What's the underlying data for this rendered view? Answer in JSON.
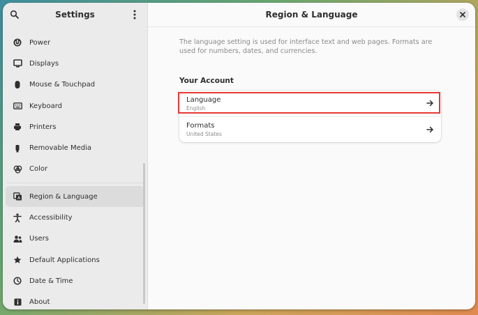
{
  "sidebar": {
    "title": "Settings",
    "items": [
      {
        "label": "Power",
        "icon": "power-icon"
      },
      {
        "label": "Displays",
        "icon": "display-icon"
      },
      {
        "label": "Mouse & Touchpad",
        "icon": "mouse-icon"
      },
      {
        "label": "Keyboard",
        "icon": "keyboard-icon"
      },
      {
        "label": "Printers",
        "icon": "printer-icon"
      },
      {
        "label": "Removable Media",
        "icon": "usb-icon"
      },
      {
        "label": "Color",
        "icon": "color-icon"
      },
      {
        "label": "Region & Language",
        "icon": "region-icon",
        "active": true
      },
      {
        "label": "Accessibility",
        "icon": "accessibility-icon"
      },
      {
        "label": "Users",
        "icon": "users-icon"
      },
      {
        "label": "Default Applications",
        "icon": "star-icon"
      },
      {
        "label": "Date & Time",
        "icon": "clock-icon"
      },
      {
        "label": "About",
        "icon": "info-icon"
      }
    ]
  },
  "main": {
    "title": "Region & Language",
    "description": "The language setting is used for interface text and web pages. Formats are used for numbers, dates, and currencies.",
    "section_title": "Your Account",
    "rows": [
      {
        "title": "Language",
        "subtitle": "English"
      },
      {
        "title": "Formats",
        "subtitle": "United States"
      }
    ]
  },
  "colors": {
    "highlight": "#e53935",
    "active_item": "#dcdcdc"
  }
}
